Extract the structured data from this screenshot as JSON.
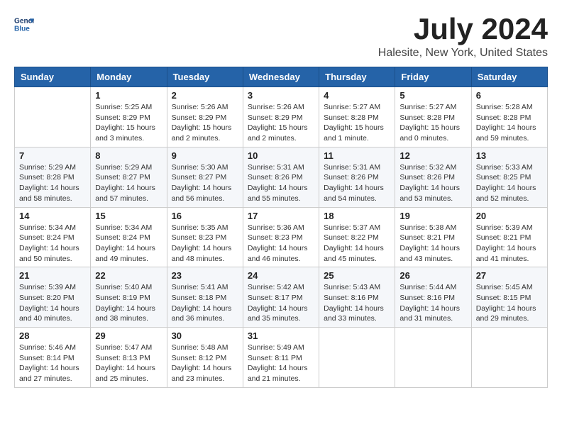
{
  "header": {
    "logo": {
      "line1": "General",
      "line2": "Blue"
    },
    "title": "July 2024",
    "location": "Halesite, New York, United States"
  },
  "weekdays": [
    "Sunday",
    "Monday",
    "Tuesday",
    "Wednesday",
    "Thursday",
    "Friday",
    "Saturday"
  ],
  "weeks": [
    [
      {
        "day": "",
        "sunrise": "",
        "sunset": "",
        "daylight": ""
      },
      {
        "day": "1",
        "sunrise": "Sunrise: 5:25 AM",
        "sunset": "Sunset: 8:29 PM",
        "daylight": "Daylight: 15 hours and 3 minutes."
      },
      {
        "day": "2",
        "sunrise": "Sunrise: 5:26 AM",
        "sunset": "Sunset: 8:29 PM",
        "daylight": "Daylight: 15 hours and 2 minutes."
      },
      {
        "day": "3",
        "sunrise": "Sunrise: 5:26 AM",
        "sunset": "Sunset: 8:29 PM",
        "daylight": "Daylight: 15 hours and 2 minutes."
      },
      {
        "day": "4",
        "sunrise": "Sunrise: 5:27 AM",
        "sunset": "Sunset: 8:28 PM",
        "daylight": "Daylight: 15 hours and 1 minute."
      },
      {
        "day": "5",
        "sunrise": "Sunrise: 5:27 AM",
        "sunset": "Sunset: 8:28 PM",
        "daylight": "Daylight: 15 hours and 0 minutes."
      },
      {
        "day": "6",
        "sunrise": "Sunrise: 5:28 AM",
        "sunset": "Sunset: 8:28 PM",
        "daylight": "Daylight: 14 hours and 59 minutes."
      }
    ],
    [
      {
        "day": "7",
        "sunrise": "Sunrise: 5:29 AM",
        "sunset": "Sunset: 8:28 PM",
        "daylight": "Daylight: 14 hours and 58 minutes."
      },
      {
        "day": "8",
        "sunrise": "Sunrise: 5:29 AM",
        "sunset": "Sunset: 8:27 PM",
        "daylight": "Daylight: 14 hours and 57 minutes."
      },
      {
        "day": "9",
        "sunrise": "Sunrise: 5:30 AM",
        "sunset": "Sunset: 8:27 PM",
        "daylight": "Daylight: 14 hours and 56 minutes."
      },
      {
        "day": "10",
        "sunrise": "Sunrise: 5:31 AM",
        "sunset": "Sunset: 8:26 PM",
        "daylight": "Daylight: 14 hours and 55 minutes."
      },
      {
        "day": "11",
        "sunrise": "Sunrise: 5:31 AM",
        "sunset": "Sunset: 8:26 PM",
        "daylight": "Daylight: 14 hours and 54 minutes."
      },
      {
        "day": "12",
        "sunrise": "Sunrise: 5:32 AM",
        "sunset": "Sunset: 8:26 PM",
        "daylight": "Daylight: 14 hours and 53 minutes."
      },
      {
        "day": "13",
        "sunrise": "Sunrise: 5:33 AM",
        "sunset": "Sunset: 8:25 PM",
        "daylight": "Daylight: 14 hours and 52 minutes."
      }
    ],
    [
      {
        "day": "14",
        "sunrise": "Sunrise: 5:34 AM",
        "sunset": "Sunset: 8:24 PM",
        "daylight": "Daylight: 14 hours and 50 minutes."
      },
      {
        "day": "15",
        "sunrise": "Sunrise: 5:34 AM",
        "sunset": "Sunset: 8:24 PM",
        "daylight": "Daylight: 14 hours and 49 minutes."
      },
      {
        "day": "16",
        "sunrise": "Sunrise: 5:35 AM",
        "sunset": "Sunset: 8:23 PM",
        "daylight": "Daylight: 14 hours and 48 minutes."
      },
      {
        "day": "17",
        "sunrise": "Sunrise: 5:36 AM",
        "sunset": "Sunset: 8:23 PM",
        "daylight": "Daylight: 14 hours and 46 minutes."
      },
      {
        "day": "18",
        "sunrise": "Sunrise: 5:37 AM",
        "sunset": "Sunset: 8:22 PM",
        "daylight": "Daylight: 14 hours and 45 minutes."
      },
      {
        "day": "19",
        "sunrise": "Sunrise: 5:38 AM",
        "sunset": "Sunset: 8:21 PM",
        "daylight": "Daylight: 14 hours and 43 minutes."
      },
      {
        "day": "20",
        "sunrise": "Sunrise: 5:39 AM",
        "sunset": "Sunset: 8:21 PM",
        "daylight": "Daylight: 14 hours and 41 minutes."
      }
    ],
    [
      {
        "day": "21",
        "sunrise": "Sunrise: 5:39 AM",
        "sunset": "Sunset: 8:20 PM",
        "daylight": "Daylight: 14 hours and 40 minutes."
      },
      {
        "day": "22",
        "sunrise": "Sunrise: 5:40 AM",
        "sunset": "Sunset: 8:19 PM",
        "daylight": "Daylight: 14 hours and 38 minutes."
      },
      {
        "day": "23",
        "sunrise": "Sunrise: 5:41 AM",
        "sunset": "Sunset: 8:18 PM",
        "daylight": "Daylight: 14 hours and 36 minutes."
      },
      {
        "day": "24",
        "sunrise": "Sunrise: 5:42 AM",
        "sunset": "Sunset: 8:17 PM",
        "daylight": "Daylight: 14 hours and 35 minutes."
      },
      {
        "day": "25",
        "sunrise": "Sunrise: 5:43 AM",
        "sunset": "Sunset: 8:16 PM",
        "daylight": "Daylight: 14 hours and 33 minutes."
      },
      {
        "day": "26",
        "sunrise": "Sunrise: 5:44 AM",
        "sunset": "Sunset: 8:16 PM",
        "daylight": "Daylight: 14 hours and 31 minutes."
      },
      {
        "day": "27",
        "sunrise": "Sunrise: 5:45 AM",
        "sunset": "Sunset: 8:15 PM",
        "daylight": "Daylight: 14 hours and 29 minutes."
      }
    ],
    [
      {
        "day": "28",
        "sunrise": "Sunrise: 5:46 AM",
        "sunset": "Sunset: 8:14 PM",
        "daylight": "Daylight: 14 hours and 27 minutes."
      },
      {
        "day": "29",
        "sunrise": "Sunrise: 5:47 AM",
        "sunset": "Sunset: 8:13 PM",
        "daylight": "Daylight: 14 hours and 25 minutes."
      },
      {
        "day": "30",
        "sunrise": "Sunrise: 5:48 AM",
        "sunset": "Sunset: 8:12 PM",
        "daylight": "Daylight: 14 hours and 23 minutes."
      },
      {
        "day": "31",
        "sunrise": "Sunrise: 5:49 AM",
        "sunset": "Sunset: 8:11 PM",
        "daylight": "Daylight: 14 hours and 21 minutes."
      },
      {
        "day": "",
        "sunrise": "",
        "sunset": "",
        "daylight": ""
      },
      {
        "day": "",
        "sunrise": "",
        "sunset": "",
        "daylight": ""
      },
      {
        "day": "",
        "sunrise": "",
        "sunset": "",
        "daylight": ""
      }
    ]
  ]
}
